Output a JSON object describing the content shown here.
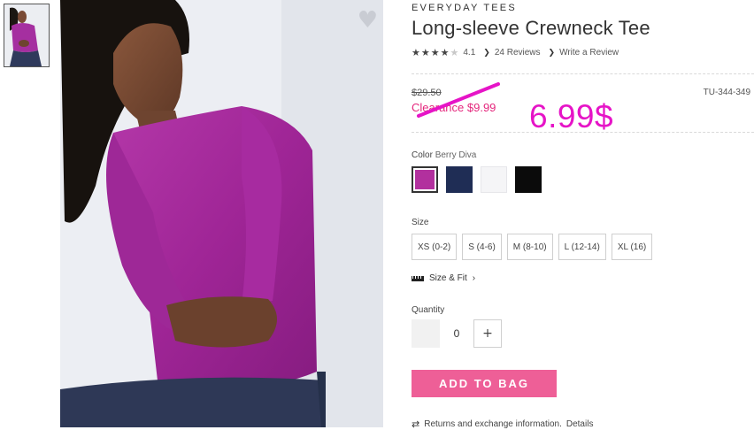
{
  "product": {
    "category": "EVERYDAY TEES",
    "title": "Long-sleeve Crewneck Tee",
    "rating": {
      "value": "4.1",
      "stars_filled": 4,
      "stars_total": 5,
      "reviews_link": "24 Reviews",
      "write_review_link": "Write a Review"
    }
  },
  "pricing": {
    "original_price": "$29.50",
    "clearance_price": "Clearance $9.99",
    "handwritten_price": "6.99$",
    "sku": "TU-344-349",
    "annotation_color": "#e614c7",
    "clearance_color": "#e4267c"
  },
  "color_picker": {
    "label": "Color",
    "selected": "Berry Diva",
    "swatches": [
      {
        "name": "Berry Diva",
        "hex": "#b2309e",
        "selected": true
      },
      {
        "name": "Navy",
        "hex": "#1f2d55",
        "selected": false
      },
      {
        "name": "White",
        "hex": "#f5f5f7",
        "selected": false
      },
      {
        "name": "Black",
        "hex": "#0b0b0b",
        "selected": false
      }
    ]
  },
  "size_picker": {
    "label": "Size",
    "options": [
      "XS (0-2)",
      "S (4-6)",
      "M (8-10)",
      "L (12-14)",
      "XL (16)"
    ]
  },
  "size_fit": {
    "label": "Size & Fit",
    "chevron": "›"
  },
  "quantity": {
    "label": "Quantity",
    "value": "0",
    "plus": "+"
  },
  "add_to_bag": {
    "label": "ADD TO BAG",
    "color": "#ee5f97"
  },
  "returns": {
    "text": "Returns and exchange information.",
    "link": "Details"
  },
  "icons": {
    "favorite": "heart-icon",
    "size_fit": "ruler-icon",
    "returns": "exchange-arrows-icon"
  }
}
